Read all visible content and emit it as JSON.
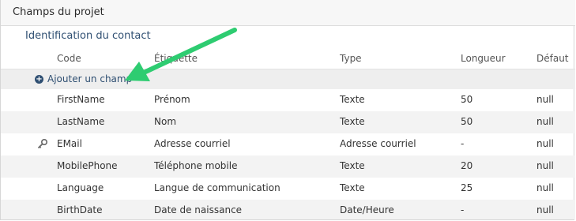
{
  "panel": {
    "title": "Champs du projet"
  },
  "section": {
    "title": "Identification du contact"
  },
  "table": {
    "headers": [
      "Code",
      "Étiquette",
      "Type",
      "Longueur",
      "Défaut"
    ],
    "add_field_label": "Ajouter un champ",
    "rows": [
      {
        "code": "FirstName",
        "label": "Prénom",
        "type": "Texte",
        "length": "50",
        "default": "null",
        "key": false
      },
      {
        "code": "LastName",
        "label": "Nom",
        "type": "Texte",
        "length": "50",
        "default": "null",
        "key": false
      },
      {
        "code": "EMail",
        "label": "Adresse courriel",
        "type": "Adresse courriel",
        "length": "-",
        "default": "null",
        "key": true
      },
      {
        "code": "MobilePhone",
        "label": "Téléphone mobile",
        "type": "Texte",
        "length": "20",
        "default": "null",
        "key": false
      },
      {
        "code": "Language",
        "label": "Langue de communication",
        "type": "Texte",
        "length": "25",
        "default": "null",
        "key": false
      },
      {
        "code": "BirthDate",
        "label": "Date de naissance",
        "type": "Date/Heure",
        "length": "-",
        "default": "null",
        "key": false
      }
    ]
  },
  "colors": {
    "accent": "#2f4f72",
    "arrow": "#2ecc71",
    "row_alt": "#f3f3f3"
  },
  "icons": {
    "add": "plus-circle-icon",
    "key": "key-icon",
    "annotation": "arrow-icon"
  }
}
